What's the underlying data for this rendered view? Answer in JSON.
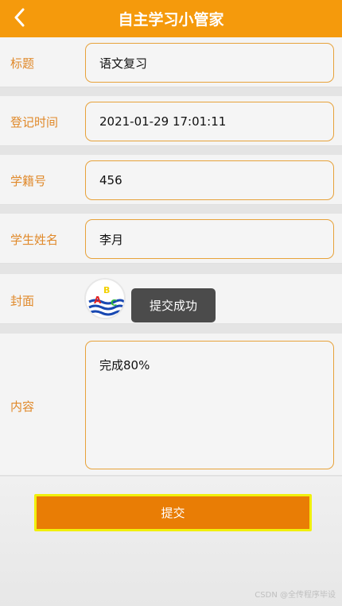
{
  "header": {
    "title": "自主学习小管家"
  },
  "form": {
    "title": {
      "label": "标题",
      "value": "语文复习"
    },
    "register_time": {
      "label": "登记时间",
      "value": "2021-01-29 17:01:11"
    },
    "student_id": {
      "label": "学籍号",
      "value": "456"
    },
    "student_name": {
      "label": "学生姓名",
      "value": "李月"
    },
    "cover": {
      "label": "封面"
    },
    "content": {
      "label": "内容",
      "value": "完成80%"
    }
  },
  "toast": {
    "text": "提交成功"
  },
  "actions": {
    "submit_label": "提交"
  },
  "watermark": {
    "text": "CSDN @全传程序毕设"
  },
  "colors": {
    "accent": "#f59a0c",
    "label": "#e0892a",
    "submit": "#e97d05",
    "submit_border": "#f1f00c",
    "toast": "#4b4b4b"
  }
}
